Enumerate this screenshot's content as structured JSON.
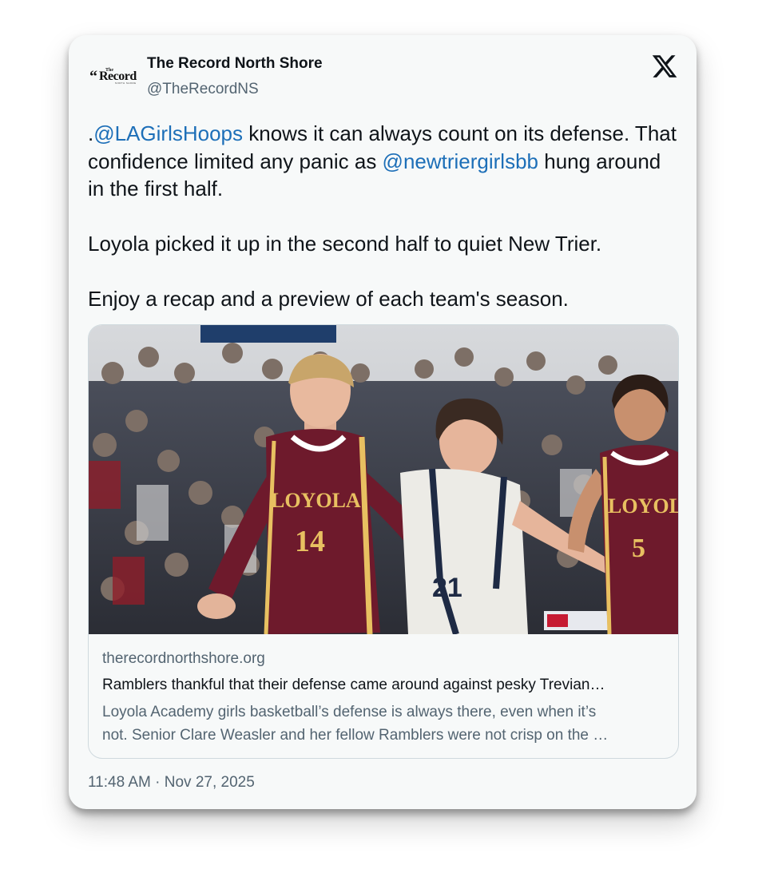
{
  "account": {
    "display_name": "The Record North Shore",
    "handle": "@TheRecordNS",
    "logo_text": "Record",
    "logo_small_text": "The",
    "logo_tagline": "NORTH SHORE",
    "logo_quote": "“"
  },
  "platform_icon": "x-logo-icon",
  "tweet": {
    "line1_prefix": ".",
    "mention1": "@LAGirlsHoops",
    "line1_rest": " knows it can always count on its defense. That confidence limited any panic as ",
    "mention2": "@newtriergirlsbb",
    "line1_end": " hung around in the first half.",
    "paragraph2": "Loyola picked it up in the second half to quiet New Trier.",
    "paragraph3": "Enjoy a recap and a preview of each team's season."
  },
  "link_card": {
    "domain": "therecordnorthshore.org",
    "headline": "Ramblers thankful that their defense came around against pesky Trevian…",
    "description_line1": "Loyola Academy girls basketball’s defense is always there, even when it’s",
    "description_line2": "not. Senior Clare Weasler and her fellow Ramblers were not crisp on the …",
    "photo": {
      "jersey_left_team": "LOYOLA",
      "jersey_left_number": "14",
      "jersey_right_team": "LOYOLA",
      "jersey_right_number": "5",
      "jersey_middle_number": "21"
    }
  },
  "timestamp": "11:48 AM · Nov 27, 2025",
  "colors": {
    "mention": "#1d6fb8",
    "card_background": "#f7f9f9",
    "secondary_text": "#536471",
    "jersey_maroon": "#6e1a2c",
    "jersey_gold": "#e8c061"
  }
}
